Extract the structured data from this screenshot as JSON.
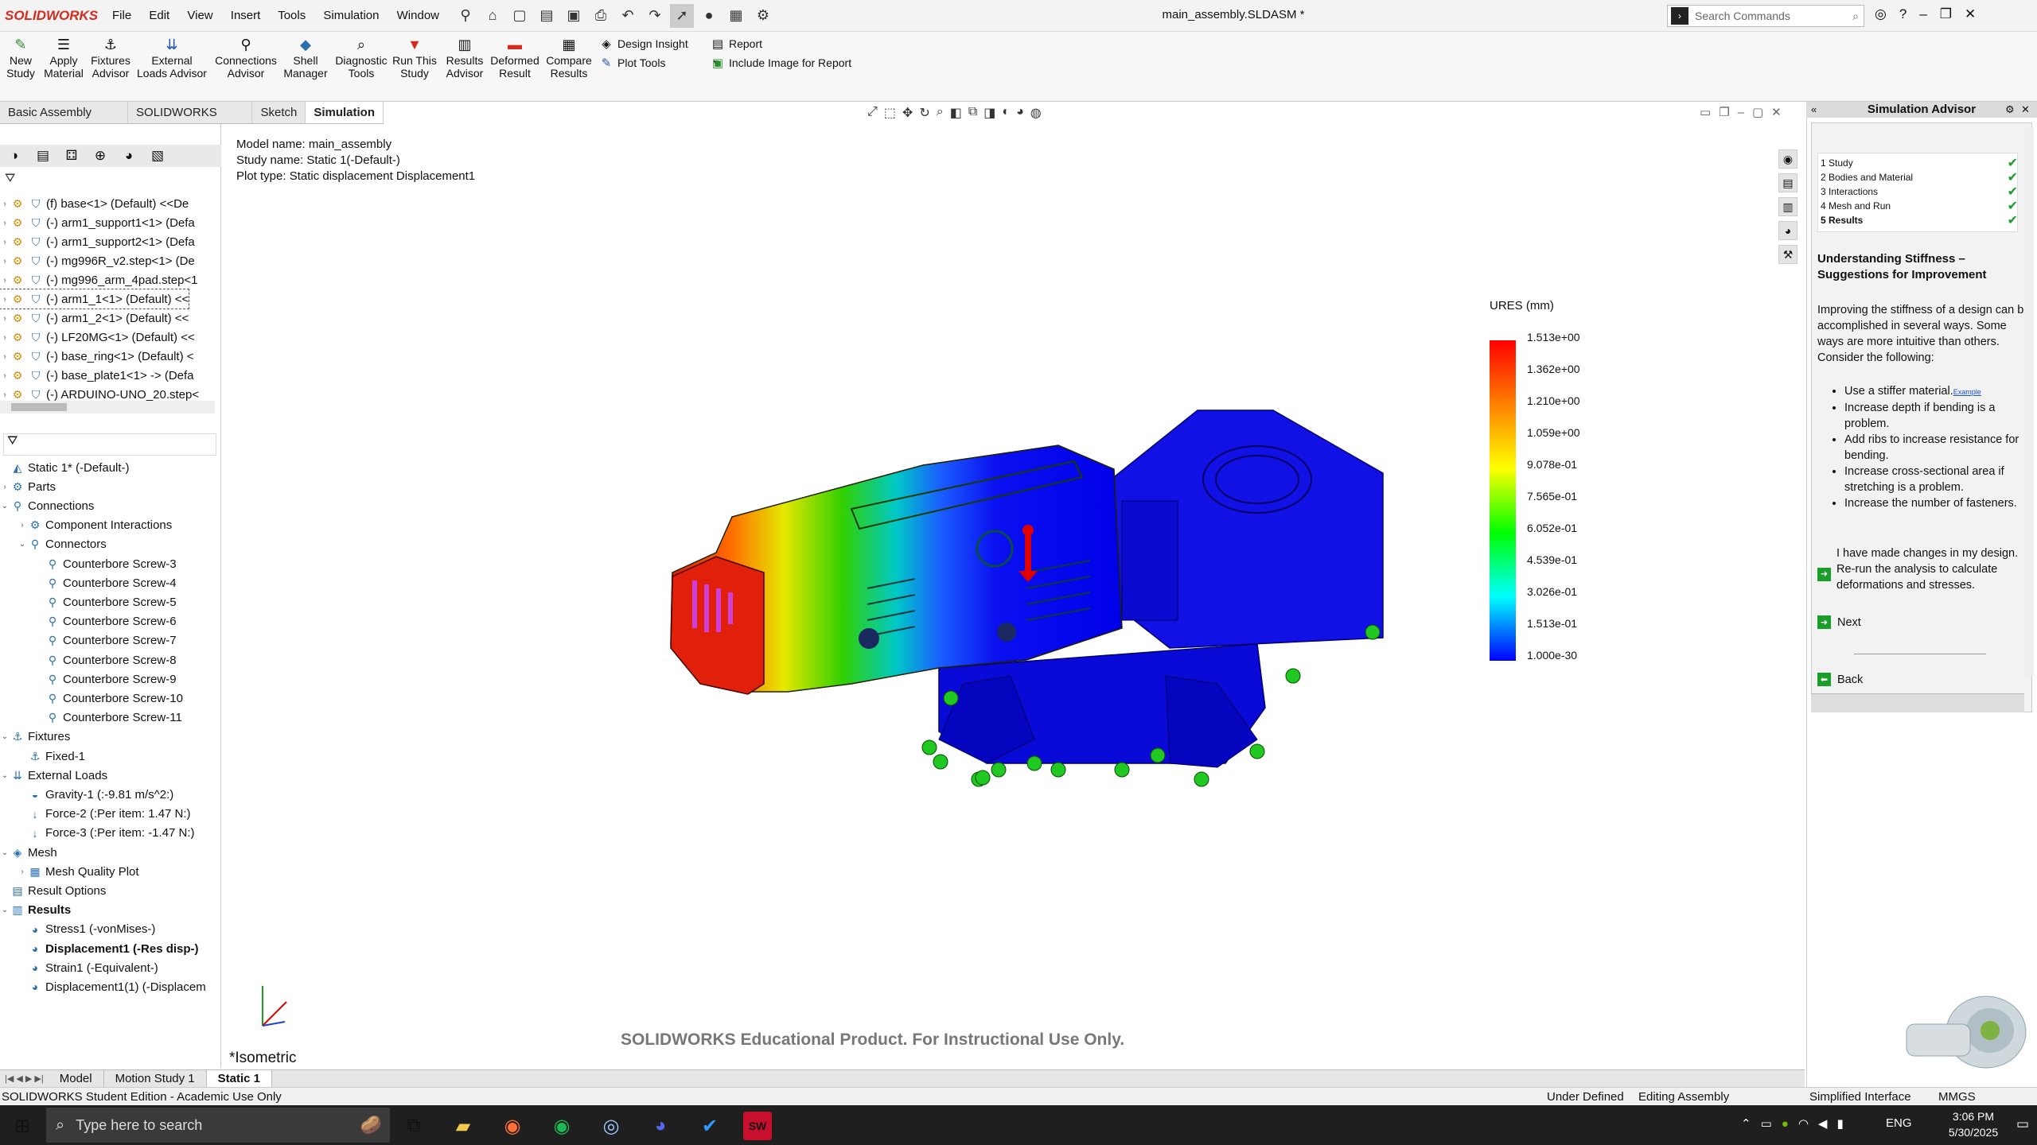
{
  "app": {
    "logo": "SOLIDWORKS",
    "window_title": "main_assembly.SLDASM *"
  },
  "menu": [
    "File",
    "Edit",
    "View",
    "Insert",
    "Tools",
    "Simulation",
    "Window"
  ],
  "search": {
    "placeholder": "Search Commands"
  },
  "ribbon": {
    "new_study": "New Study",
    "apply_material": "Apply Material",
    "fixtures_advisor": "Fixtures Advisor",
    "external_loads_advisor": "External Loads Advisor",
    "connections_advisor": "Connections Advisor",
    "shell_manager": "Shell Manager",
    "diagnostic_tools": "Diagnostic Tools",
    "run_this_study": "Run This Study",
    "results_advisor": "Results Advisor",
    "deformed_result": "Deformed Result",
    "compare_results": "Compare Results",
    "design_insight": "Design Insight",
    "plot_tools": "Plot Tools",
    "report": "Report",
    "include_image": "Include Image for Report"
  },
  "cmd_tabs": [
    "Basic Assembly Tools",
    "SOLIDWORKS CAM",
    "Sketch",
    "Simulation"
  ],
  "feature_tree": [
    "(f) base<1> (Default) <<De",
    "(-) arm1_support1<1> (Defa",
    "(-) arm1_support2<1> (Defa",
    "(-) mg996R_v2.step<1> (De",
    "(-) mg996_arm_4pad.step<1",
    "(-) arm1_1<1> (Default) <<",
    "(-) arm1_2<1> (Default) <<",
    "(-) LF20MG<1> (Default) <<",
    "(-) base_ring<1> (Default) <",
    "(-) base_plate1<1> -> (Defa",
    "(-) ARDUINO-UNO_20.step<"
  ],
  "sim_tree": {
    "study": "Static 1* (-Default-)",
    "parts": "Parts",
    "connections": "Connections",
    "component_interactions": "Component Interactions",
    "connectors": "Connectors",
    "screws": [
      "Counterbore Screw-3",
      "Counterbore Screw-4",
      "Counterbore Screw-5",
      "Counterbore Screw-6",
      "Counterbore Screw-7",
      "Counterbore Screw-8",
      "Counterbore Screw-9",
      "Counterbore Screw-10",
      "Counterbore Screw-11"
    ],
    "fixtures": "Fixtures",
    "fixed": "Fixed-1",
    "external_loads": "External Loads",
    "gravity": "Gravity-1 (:-9.81 m/s^2:)",
    "force2": "Force-2 (:Per item: 1.47 N:)",
    "force3": "Force-3 (:Per item: -1.47 N:)",
    "mesh": "Mesh",
    "mesh_quality": "Mesh Quality Plot",
    "result_options": "Result Options",
    "results": "Results",
    "stress": "Stress1 (-vonMises-)",
    "displacement": "Displacement1 (-Res disp-)",
    "strain": "Strain1 (-Equivalent-)",
    "displacement2": "Displacement1(1) (-Displacem"
  },
  "viewport": {
    "model_name": "Model name: main_assembly",
    "study_name": "Study name: Static 1(-Default-)",
    "plot_type": "Plot type: Static displacement Displacement1",
    "legend_title": "URES (mm)",
    "legend_values": [
      "1.513e+00",
      "1.362e+00",
      "1.210e+00",
      "1.059e+00",
      "9.078e-01",
      "7.565e-01",
      "6.052e-01",
      "4.539e-01",
      "3.026e-01",
      "1.513e-01",
      "1.000e-30"
    ],
    "watermark": "SOLIDWORKS Educational Product. For Instructional Use Only.",
    "view_label": "*Isometric"
  },
  "bottom_tabs": [
    "Model",
    "Motion Study 1",
    "Static 1"
  ],
  "status": {
    "left": "SOLIDWORKS Student Edition - Academic Use Only",
    "under_defined": "Under Defined",
    "editing": "Editing Assembly",
    "simplified": "Simplified Interface",
    "units": "MMGS"
  },
  "advisor": {
    "title": "Simulation Advisor",
    "steps": [
      "1  Study",
      "2  Bodies and Material",
      "3  Interactions",
      "4  Mesh and Run",
      "5  Results"
    ],
    "heading": "Understanding Stiffness – Suggestions for Improvement",
    "intro": "Improving the stiffness of a design can be accomplished in several ways. Some ways are more intuitive than others. Consider the following:",
    "bullets": [
      "Use a stiffer material.",
      "Increase depth if bending is a problem.",
      "Add ribs to increase resistance for bending.",
      "Increase cross-sectional area if stretching is a problem.",
      "Increase the number of fasteners."
    ],
    "example_link": "Example",
    "rerun": "I have made changes in my design. Re-run the analysis to calculate deformations and stresses.",
    "next": "Next",
    "back": "Back"
  },
  "taskbar": {
    "search_placeholder": "Type here to search",
    "time": "3:06 PM",
    "date": "5/30/2025",
    "lang": "ENG"
  }
}
